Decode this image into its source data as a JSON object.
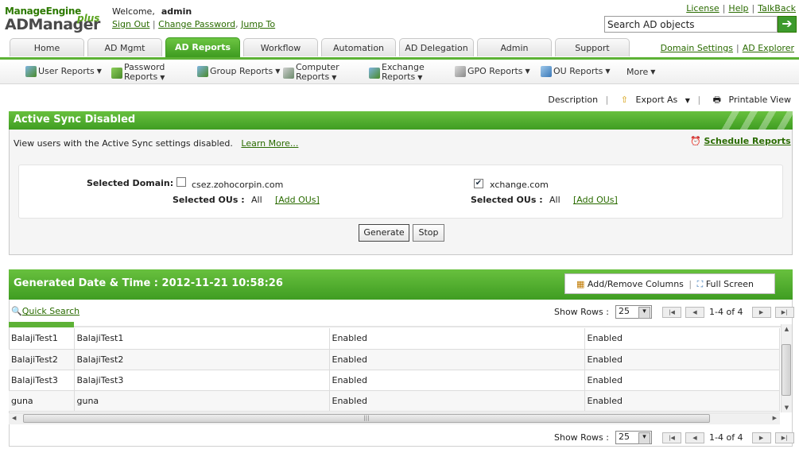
{
  "header": {
    "brand_top": "ManageEngine",
    "brand_main": "ADManager",
    "brand_plus": "plus",
    "welcome_label": "Welcome,",
    "username": "admin",
    "sign_out": "Sign Out",
    "change_password": "Change Password",
    "jump_to": "Jump To",
    "license": "License",
    "help": "Help",
    "talkback": "TalkBack",
    "search_placeholder": "Search AD objects"
  },
  "tabs": [
    "Home",
    "AD Mgmt",
    "AD Reports",
    "Workflow",
    "Automation",
    "AD Delegation",
    "Admin",
    "Support"
  ],
  "active_tab": "AD Reports",
  "tab_links": {
    "domain_settings": "Domain Settings",
    "ad_explorer": "AD Explorer"
  },
  "subnav": {
    "user_reports": "User Reports",
    "password_reports_1": "Password",
    "password_reports_2": "Reports",
    "group_reports": "Group Reports",
    "computer_reports_1": "Computer",
    "computer_reports_2": "Reports",
    "exchange_reports_1": "Exchange",
    "exchange_reports_2": "Reports",
    "gpo_reports": "GPO Reports",
    "ou_reports": "OU Reports",
    "more": "More"
  },
  "actions": {
    "description": "Description",
    "export_as": "Export As",
    "printable_view": "Printable View"
  },
  "report": {
    "title": "Active Sync Disabled",
    "description": "View users with the Active Sync settings disabled.",
    "learn_more": "Learn More...",
    "schedule_reports": "Schedule Reports",
    "selected_domain_label": "Selected Domain:",
    "selected_ous_label": "Selected OUs :",
    "domains": [
      {
        "name": "csez.zohocorpin.com",
        "checked": false,
        "ous": "All",
        "add_ous": "[Add OUs]"
      },
      {
        "name": "xchange.com",
        "checked": true,
        "ous": "All",
        "add_ous": "[Add OUs]"
      }
    ],
    "generate": "Generate",
    "stop": "Stop"
  },
  "results": {
    "generated_label": "Generated Date & Time : 2012-11-21 10:58:26",
    "add_remove_columns": "Add/Remove Columns",
    "full_screen": "Full Screen",
    "quick_search": "Quick Search",
    "show_rows_label": "Show Rows :",
    "rows_value": "25",
    "range": "1-4 of 4",
    "rows": [
      [
        "BalajiTest1",
        "BalajiTest1",
        "Enabled",
        "Enabled"
      ],
      [
        "BalajiTest2",
        "BalajiTest2",
        "Enabled",
        "Enabled"
      ],
      [
        "BalajiTest3",
        "BalajiTest3",
        "Enabled",
        "Enabled"
      ],
      [
        "guna",
        "guna",
        "Enabled",
        "Enabled"
      ]
    ]
  },
  "colors": {
    "brand_green": "#3f9d22",
    "accent_green": "#5db236",
    "link_green": "#2a6b00"
  }
}
